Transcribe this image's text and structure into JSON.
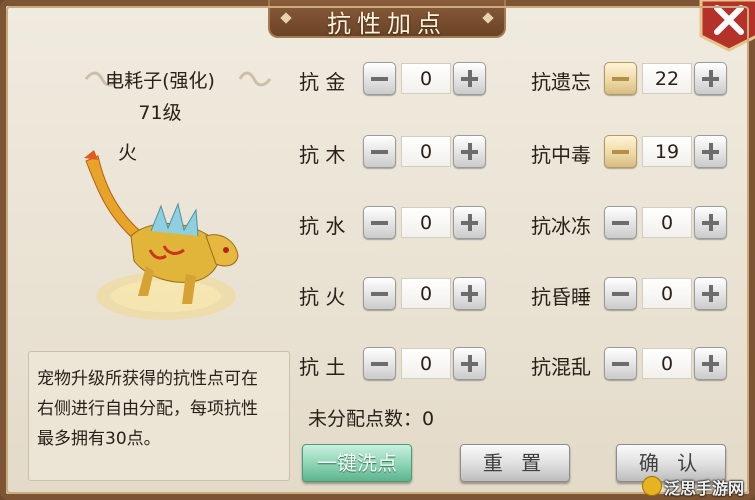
{
  "window": {
    "title": "抗性加点"
  },
  "pet": {
    "name": "电耗子(强化)",
    "level": "71级",
    "element": "火"
  },
  "description": [
    "宠物升级所获得的抗性点可在",
    "右侧进行自由分配，每项抗性",
    "最多拥有30点。"
  ],
  "resistances_left": [
    {
      "label": "抗 金",
      "value": "0"
    },
    {
      "label": "抗 木",
      "value": "0"
    },
    {
      "label": "抗 水",
      "value": "0"
    },
    {
      "label": "抗 火",
      "value": "0"
    },
    {
      "label": "抗 土",
      "value": "0"
    }
  ],
  "resistances_right": [
    {
      "label": "抗遗忘",
      "value": "22"
    },
    {
      "label": "抗中毒",
      "value": "19"
    },
    {
      "label": "抗冰冻",
      "value": "0"
    },
    {
      "label": "抗昏睡",
      "value": "0"
    },
    {
      "label": "抗混乱",
      "value": "0"
    }
  ],
  "unassigned_text": "未分配点数：0",
  "buttons": {
    "reset_all": "一键洗点",
    "reset": "重 置",
    "confirm": "确 认"
  },
  "watermark": "泛思手游网",
  "colors": {
    "frame": "#7d5535",
    "panel": "#ece6d8",
    "accent_green": "#8bd3b3",
    "accent_gold": "#efd9a6",
    "close_red": "#b5322a"
  },
  "icons": {
    "close": "close-icon",
    "minus": "minus-icon",
    "plus": "plus-icon"
  }
}
